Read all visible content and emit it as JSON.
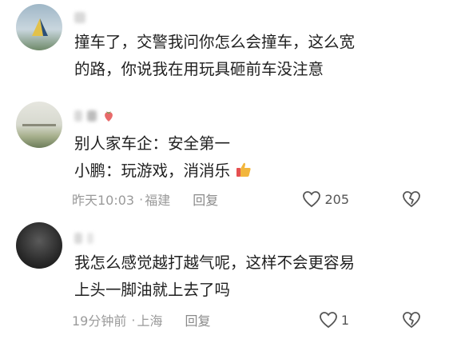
{
  "comments": [
    {
      "text_lines": [
        "撞车了，交警我问你怎么会撞车，这么宽",
        "的路，你说我在用玩具砸前车没注意"
      ]
    },
    {
      "text_lines": [
        "别人家车企：安全第一",
        "小鹏：玩游戏，消消乐"
      ],
      "time": "昨天10:03",
      "location": "福建",
      "reply_label": "回复",
      "like_count": "205"
    },
    {
      "text_lines": [
        "我怎么感觉越打越气呢，这样不会更容易",
        "上头一脚油就上去了吗"
      ],
      "time": "19分钟前",
      "location": "上海",
      "reply_label": "回复",
      "like_count": "1"
    }
  ],
  "separator": "·",
  "colors": {
    "text": "#1f1f1f",
    "meta": "#9a9a9a",
    "icon": "#555555"
  },
  "icons": [
    "heart-icon",
    "dislike-icon",
    "thumbs-up-emoji",
    "strawberry-icon"
  ]
}
